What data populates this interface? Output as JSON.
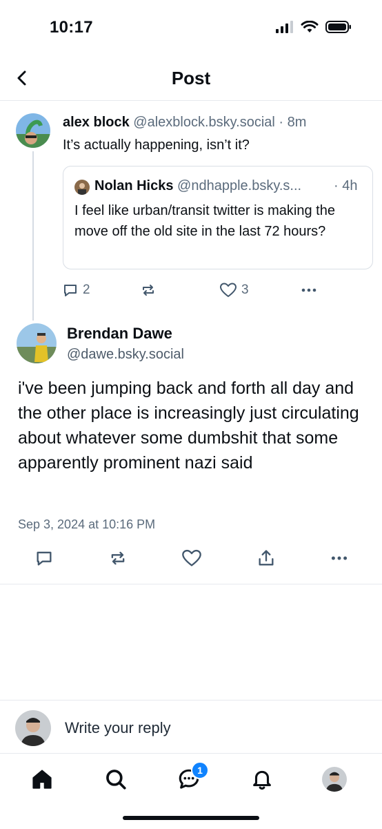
{
  "status_bar": {
    "time": "10:17"
  },
  "header": {
    "title": "Post"
  },
  "parent_post": {
    "author_name": "alex block",
    "author_handle": "@alexblock.bsky.social",
    "separator": " · ",
    "time": "8m",
    "text": "It’s actually happening, isn’t it?",
    "reply_count": "2",
    "like_count": "3",
    "quote": {
      "author_name": "Nolan Hicks",
      "author_handle": "@ndhapple.bsky.s...",
      "time": "· 4h",
      "text": "I feel like urban/transit twitter is making the move off the old site in the last 72 hours?"
    }
  },
  "main_post": {
    "author_name": "Brendan Dawe",
    "author_handle": "@dawe.bsky.social",
    "text": "i've been jumping back and forth all day and the other place is increasingly just circulating about whatever some dumbshit that some apparently prominent nazi said",
    "timestamp": "Sep 3, 2024 at 10:16 PM"
  },
  "reply_bar": {
    "placeholder": "Write your reply"
  },
  "tab_bar": {
    "chat_badge": "1"
  },
  "colors": {
    "accent": "#1083fe",
    "muted": "#5b6b7c",
    "icon": "#42576c",
    "text": "#0b0f14"
  }
}
